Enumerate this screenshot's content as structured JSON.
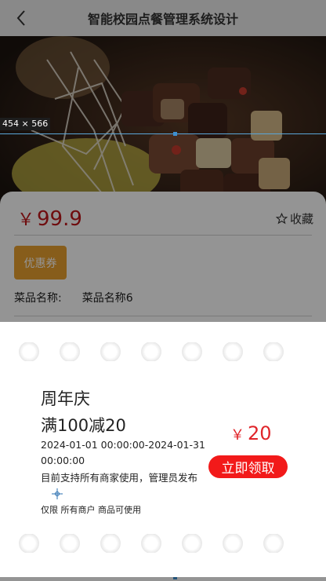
{
  "navbar": {
    "title": "智能校园点餐管理系统设计",
    "back_icon": "chevron-left-icon"
  },
  "product": {
    "price_symbol": "￥",
    "price": "99.9",
    "favorite_label": "收藏",
    "favorite_icon": "star-outline-icon",
    "coupon_button_label": "优惠券",
    "name_label": "菜品名称:",
    "name_value": "菜品名称6"
  },
  "devtools": {
    "dimension_tag": "454 × 566"
  },
  "coupon": {
    "title": "周年庆",
    "rule": "满100减20",
    "validity": "2024-01-01 00:00:00-2024-01-31 00:00:00",
    "scope": "目前支持所有商家使用，管理员发布",
    "limit": "仅限 所有商户 商品可使用",
    "amount_symbol": "￥",
    "amount": "20",
    "claim_label": "立即领取"
  },
  "colors": {
    "price": "#c0171b",
    "coupon_button": "#e9a02f",
    "claim_button": "#f21a1a",
    "coupon_amount": "#e0252a"
  }
}
